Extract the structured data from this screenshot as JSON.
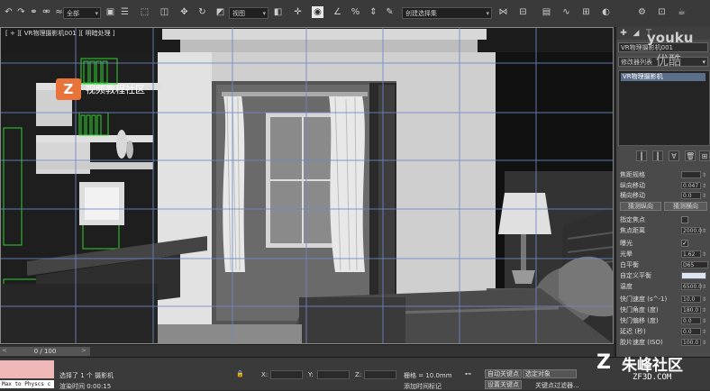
{
  "toolbar": {
    "selection_filter": "全部",
    "view_mode": "视图",
    "selection_set": "创建选择集",
    "icons": [
      "undo-icon",
      "redo-icon",
      "link-icon",
      "unlink-icon",
      "bind-space-warp-icon",
      "select-icon",
      "select-by-name-icon",
      "rect-select-icon",
      "window-crossing-icon",
      "move-icon",
      "rotate-icon",
      "scale-icon",
      "reference-coord-icon",
      "pivot-icon",
      "select-manipulate-icon",
      "snap-icon",
      "angle-snap-icon",
      "percent-snap-icon",
      "spinner-snap-icon",
      "named-selection-icon",
      "mirror-icon",
      "align-icon",
      "layer-icon",
      "curve-editor-icon",
      "schematic-icon",
      "material-editor-icon",
      "render-setup-icon",
      "render-frame-icon",
      "render-icon"
    ]
  },
  "viewport": {
    "label": "[ + ][ VR物理摄影机001 ][ 明暗处理 ]",
    "logo_letter": "Z",
    "logo_text": "视频教程社区"
  },
  "timeline": {
    "frame": "0 / 100",
    "prev": "<",
    "next": ">"
  },
  "panel": {
    "object_name": "VR物理摄影机001",
    "modifier_list": "修改器列表",
    "stack_item": "VR物理摄影机",
    "rows": [
      {
        "label": "焦距规格",
        "value": "",
        "type": "spinner"
      },
      {
        "label": "纵向移动",
        "value": "0.047",
        "type": "spinner"
      },
      {
        "label": "横向移动",
        "value": "0.0",
        "type": "spinner"
      },
      {
        "label": "指定焦点",
        "value": "",
        "type": "check"
      },
      {
        "label": "焦点距离",
        "value": "2000.0",
        "type": "spinner"
      },
      {
        "label": "曝光",
        "value": "✓",
        "type": "check"
      },
      {
        "label": "光晕",
        "value": "1.62",
        "type": "spinner"
      },
      {
        "label": "白平衡",
        "value": "D65",
        "type": "select"
      },
      {
        "label": "自定义平衡",
        "value": "",
        "type": "swatch"
      },
      {
        "label": "温度",
        "value": "6500.0",
        "type": "spinner"
      },
      {
        "label": "快门速度 (s^-1)",
        "value": "10.0",
        "type": "spinner"
      },
      {
        "label": "快门角度 (度)",
        "value": "180.0",
        "type": "spinner"
      },
      {
        "label": "快门偏移 (度)",
        "value": "0.0",
        "type": "spinner"
      },
      {
        "label": "延迟 (秒)",
        "value": "0.0",
        "type": "spinner"
      },
      {
        "label": "胶片速度 (ISO)",
        "value": "100.0",
        "type": "spinner"
      }
    ],
    "guess_vertical": "猜测纵向",
    "guess_horizontal": "猜测横向"
  },
  "status": {
    "maxscript": "Max to Physcs c",
    "selected": "选择了 1 个 摄影机",
    "prompt": "渲染时间  0:00:15",
    "x_label": "X:",
    "y_label": "Y:",
    "z_label": "Z:",
    "grid": "栅格 = 10.0mm",
    "add_time_tag": "添加时间标记",
    "auto_key": "自动关键点",
    "set_key": "设置关键点",
    "selected_filter": "选定对象",
    "key_filters": "关键点过滤器..."
  },
  "watermark": {
    "youku": "youku",
    "youku_cn": "优酷",
    "zf_logo": "Z",
    "zf_name": "朱峰社区",
    "zf_url": "ZF3D.COM"
  },
  "colors": {
    "viewport_bg": "#262626",
    "panel_bg": "#4a4a4a",
    "grid_blue": "#6f88c8",
    "selection_green": "#2ed02e",
    "logo_orange": "#e8743c"
  }
}
